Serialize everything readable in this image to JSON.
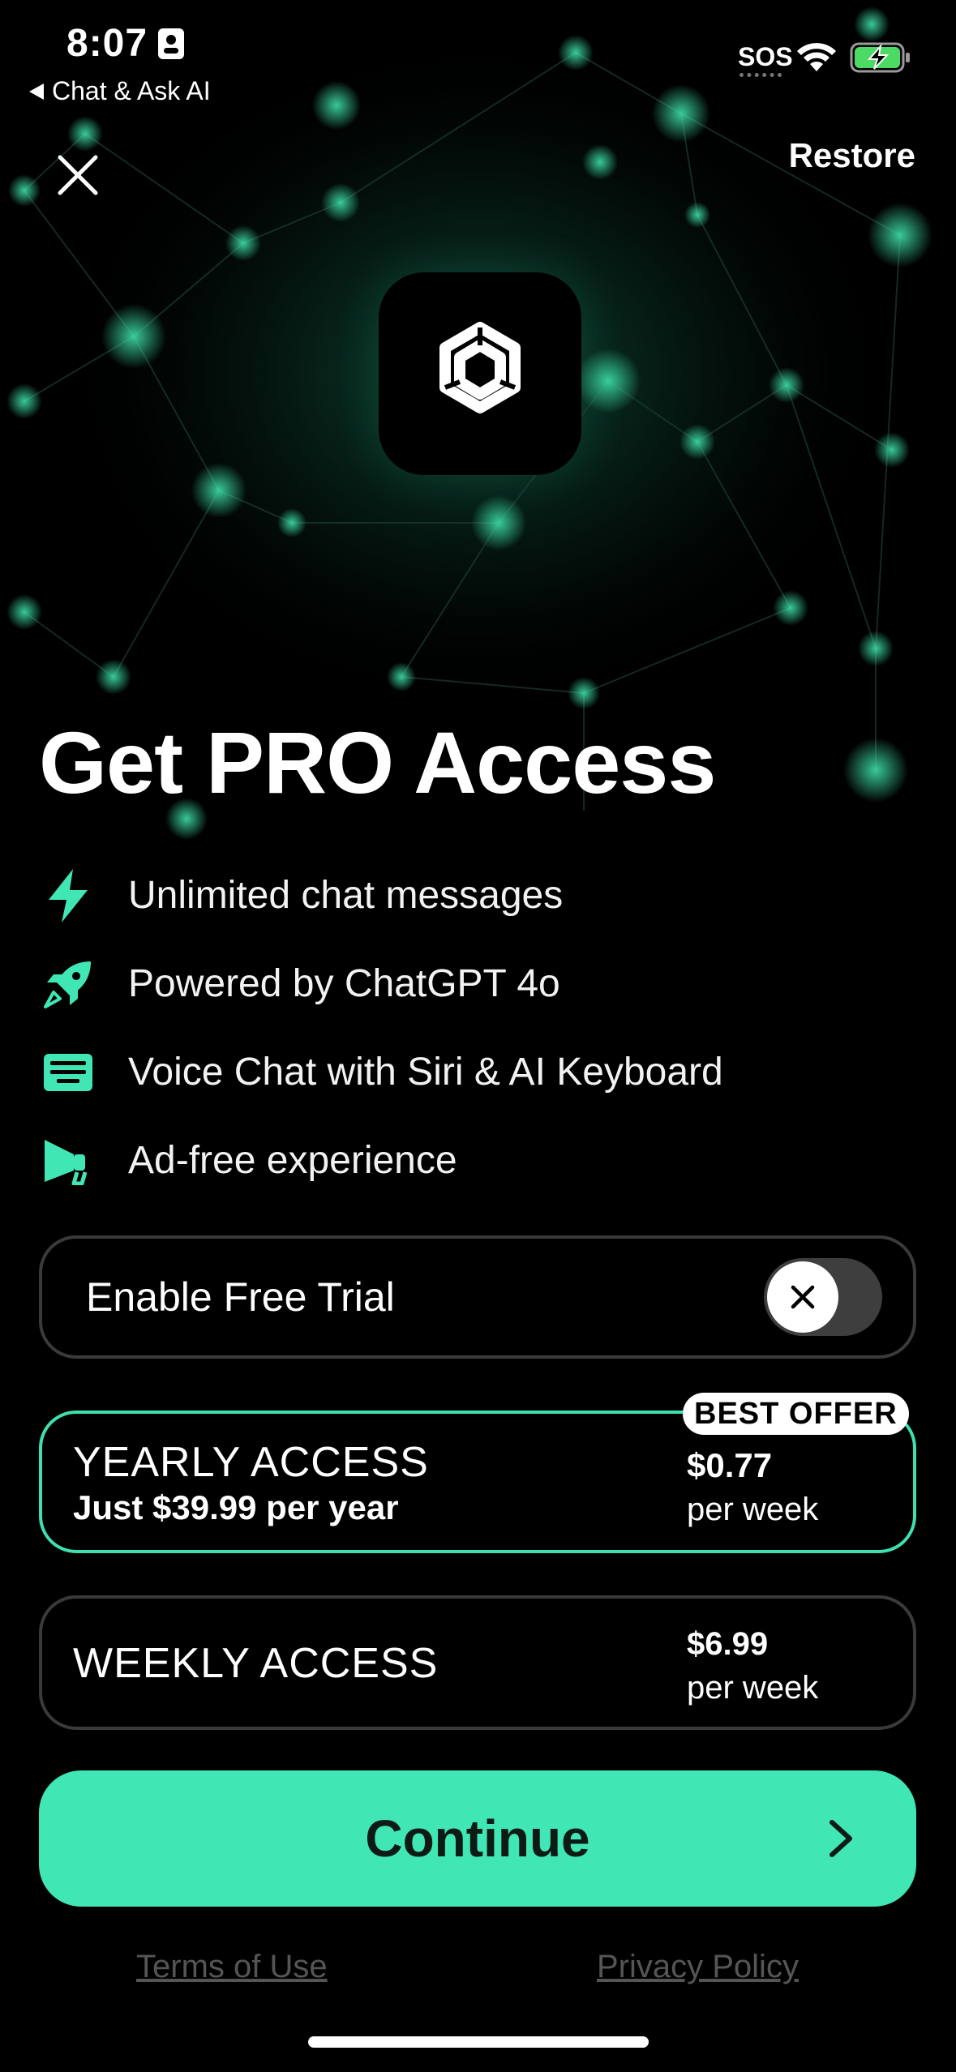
{
  "status_bar": {
    "time": "8:07",
    "back_app": "Chat & Ask AI",
    "sos": "SOS"
  },
  "header": {
    "restore_label": "Restore"
  },
  "headline": "Get PRO Access",
  "features": [
    {
      "icon": "lightning-icon",
      "text": "Unlimited chat messages"
    },
    {
      "icon": "rocket-icon",
      "text": "Powered by ChatGPT 4o"
    },
    {
      "icon": "keyboard-icon",
      "text": "Voice Chat with Siri & AI Keyboard"
    },
    {
      "icon": "megaphone-icon",
      "text": "Ad-free experience"
    }
  ],
  "trial": {
    "label": "Enable Free Trial",
    "enabled": false
  },
  "plans": {
    "yearly": {
      "badge": "BEST OFFER",
      "title": "YEARLY ACCESS",
      "subtitle": "Just $39.99 per year",
      "price": "$0.77",
      "per": "per week",
      "selected": true
    },
    "weekly": {
      "title": "WEEKLY ACCESS",
      "price": "$6.99",
      "per": "per week",
      "selected": false
    }
  },
  "cta": {
    "label": "Continue"
  },
  "footer": {
    "terms": "Terms of Use",
    "privacy": "Privacy Policy"
  },
  "colors": {
    "accent": "#40e6b4",
    "background": "#000000",
    "border": "#3a3a3a"
  }
}
